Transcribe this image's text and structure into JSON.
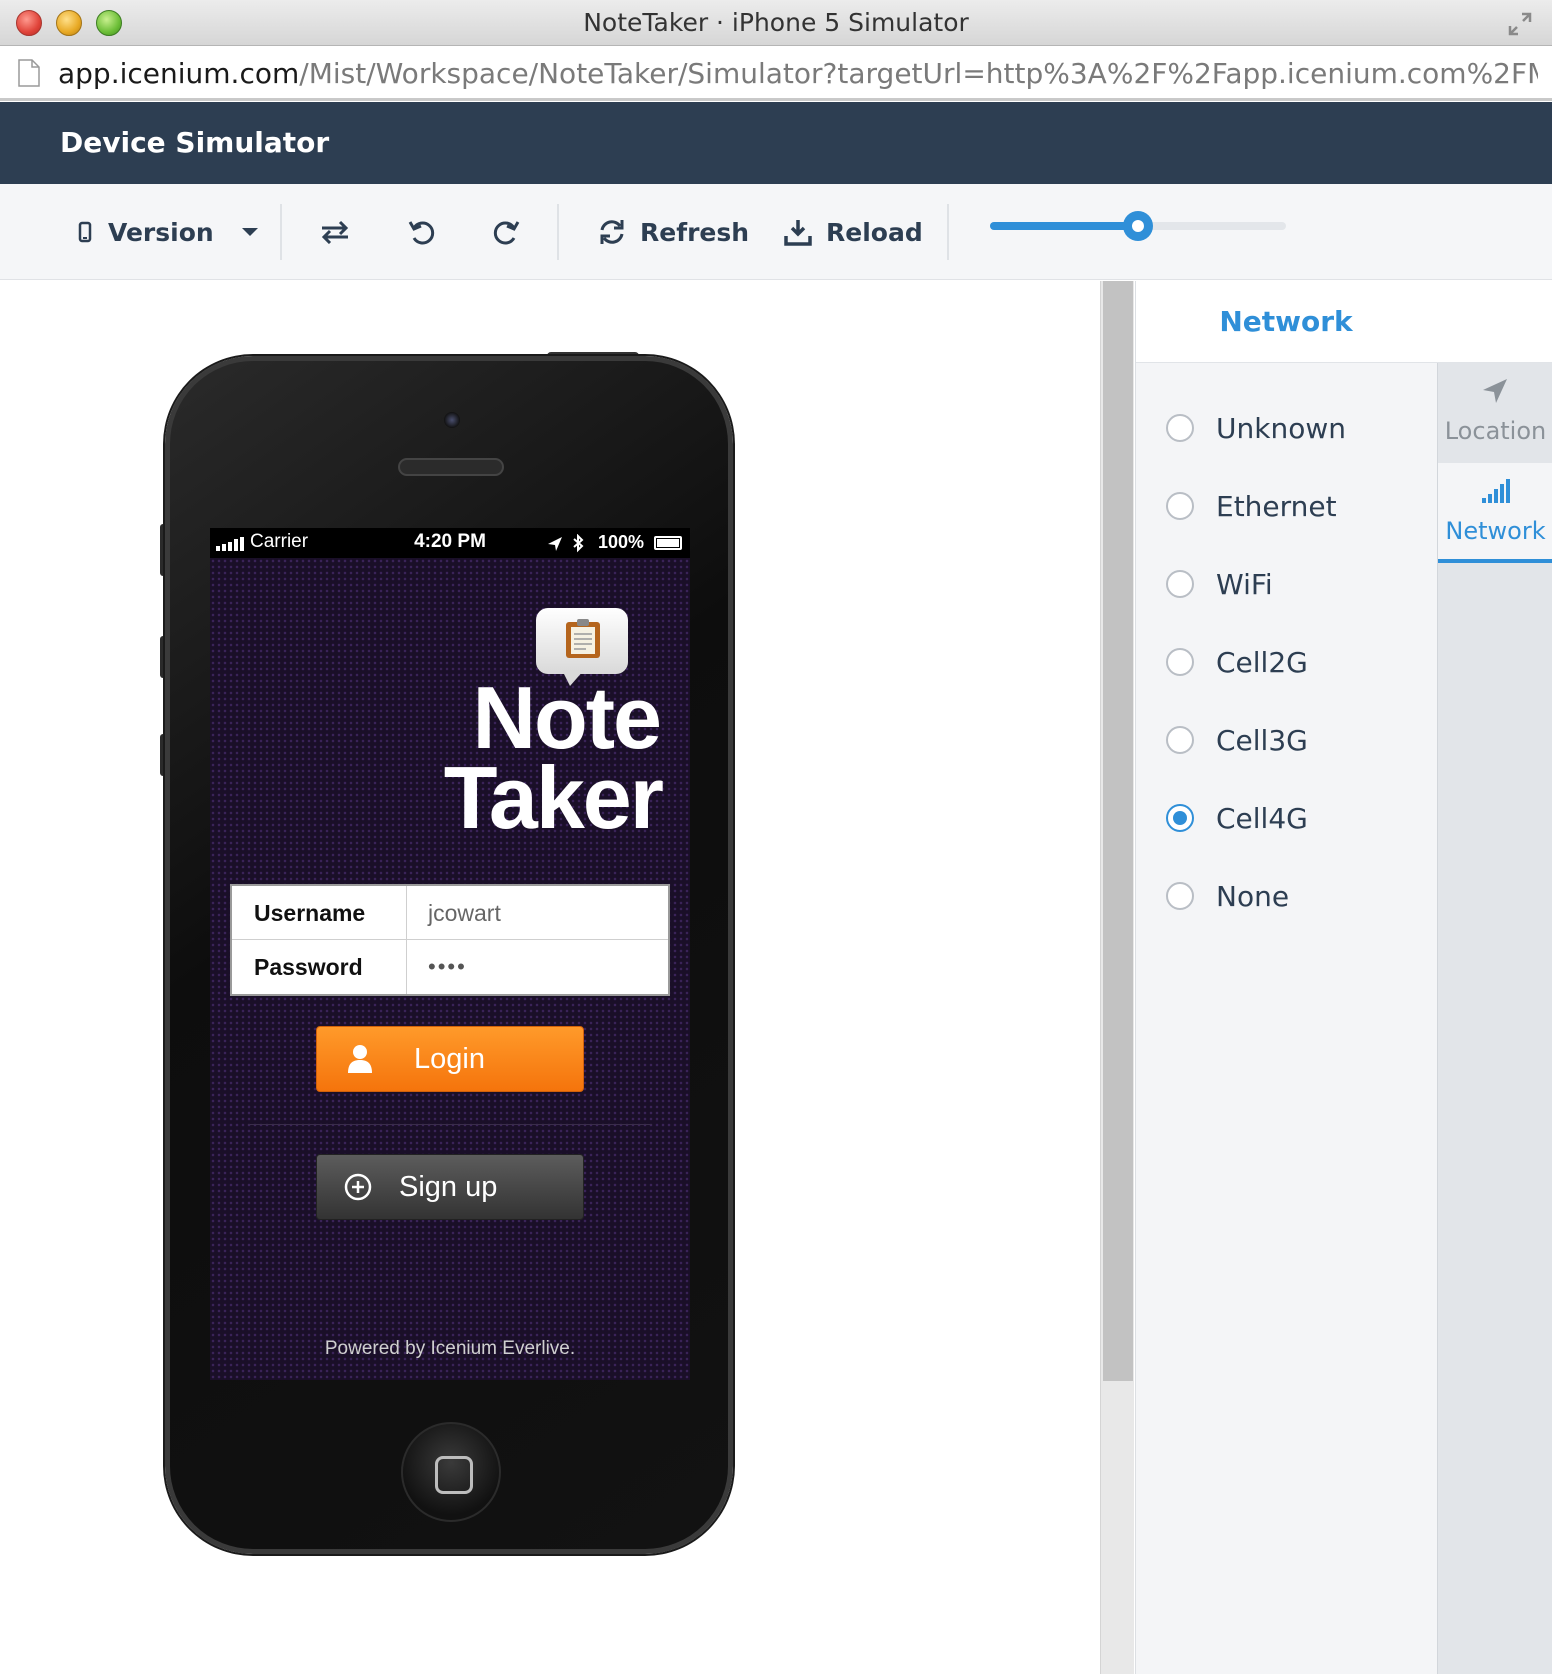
{
  "window": {
    "title": "NoteTaker · iPhone 5 Simulator",
    "url_host": "app.icenium.com",
    "url_path": "/Mist/Workspace/NoteTaker/Simulator?targetUrl=http%3A%2F%2Fapp.icenium.com%2FMi..."
  },
  "app": {
    "title": "Device Simulator"
  },
  "toolbar": {
    "version_label": "Version",
    "refresh_label": "Refresh",
    "reload_label": "Reload",
    "zoom_fraction": 0.5
  },
  "device": {
    "status": {
      "carrier": "Carrier",
      "time": "4:20 PM",
      "battery": "100%"
    },
    "logo_line1": "Note",
    "logo_line2": "Taker",
    "form": {
      "username_label": "Username",
      "username_value": "jcowart",
      "password_label": "Password",
      "password_value": "••••"
    },
    "login_label": "Login",
    "signup_label": "Sign up",
    "powered_by": "Powered by Icenium Everlive."
  },
  "panel": {
    "title": "Network",
    "options": [
      "Unknown",
      "Ethernet",
      "WiFi",
      "Cell2G",
      "Cell3G",
      "Cell4G",
      "None"
    ],
    "selected": "Cell4G",
    "tabs": {
      "location": "Location",
      "network": "Network"
    }
  },
  "colors": {
    "accent": "#2f8fd8",
    "header": "#2d3e52",
    "login": "#f5740c"
  }
}
